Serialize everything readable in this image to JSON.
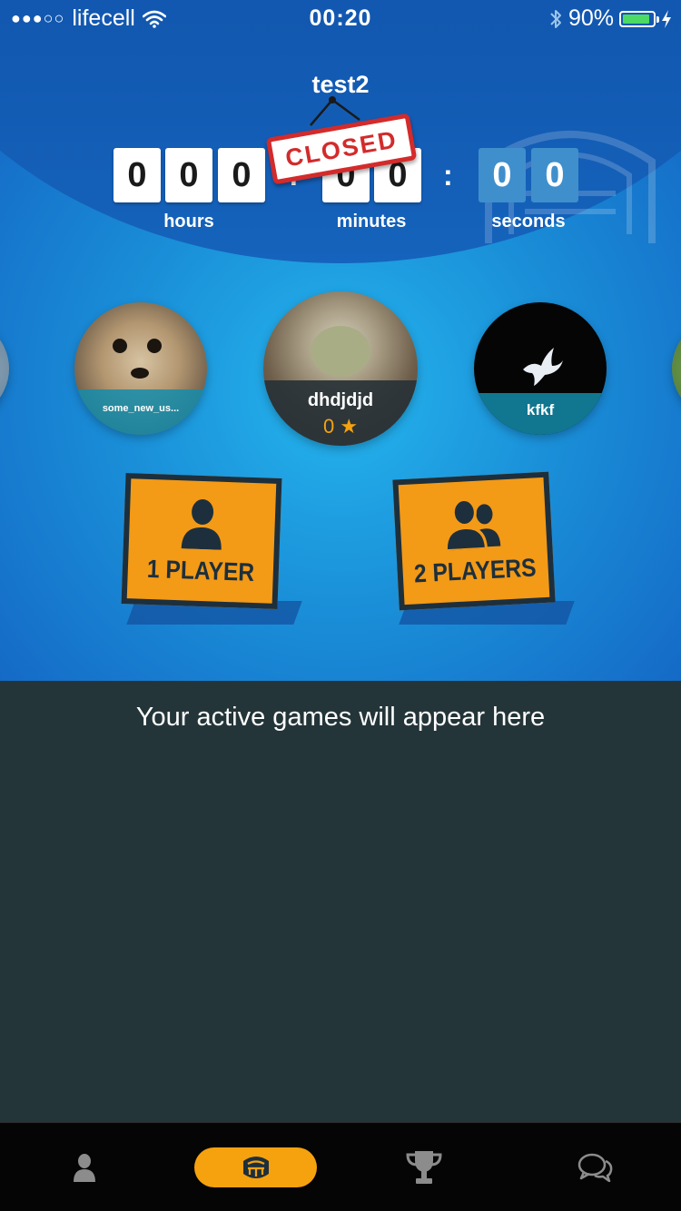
{
  "status_bar": {
    "signal_dots": "●●●○○",
    "carrier": "lifecell",
    "wifi_icon": "wifi-icon",
    "time": "00:20",
    "bluetooth_icon": "bluetooth-icon",
    "battery_percent": "90%",
    "battery_level": 0.9,
    "charging_icon": "charging-bolt-icon"
  },
  "room": {
    "title": "test2",
    "closed_label": "CLOSED"
  },
  "timer": {
    "hours": [
      "0",
      "0",
      "0"
    ],
    "minutes": [
      "0",
      "0"
    ],
    "seconds": [
      "0",
      "0"
    ],
    "separator": ":",
    "labels": {
      "hours": "hours",
      "minutes": "minutes",
      "seconds": "seconds"
    }
  },
  "players": {
    "left": {
      "name": "some_new_us..."
    },
    "center": {
      "name": "dhdjdjd",
      "score": "0"
    },
    "right": {
      "name": "kfkf"
    }
  },
  "play_buttons": {
    "single": {
      "label": "1 PLAYER",
      "icon": "single-user-icon"
    },
    "multi": {
      "label": "2 PLAYERS",
      "icon": "two-users-icon"
    }
  },
  "games": {
    "empty_message": "Your active games will appear here"
  },
  "tab_bar": {
    "active_index": 1,
    "tabs": [
      "profile-icon",
      "arena-icon",
      "trophy-icon",
      "chat-icon"
    ]
  },
  "colors": {
    "accent_orange": "#f39a17",
    "closed_red": "#d32b2b",
    "dark_panel": "#243539",
    "hero_blue": "#1466c4"
  }
}
